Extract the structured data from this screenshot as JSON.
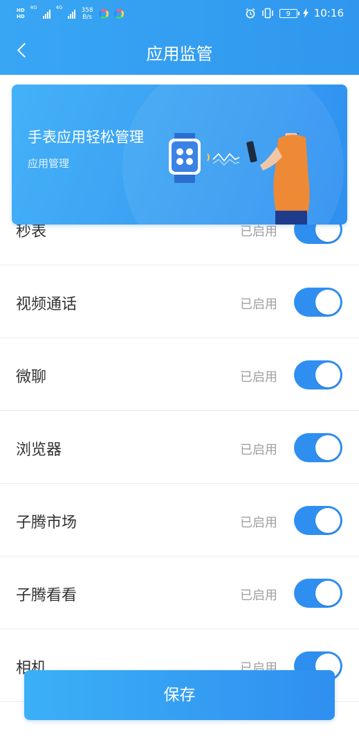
{
  "status_bar": {
    "hd1": "HD",
    "hd2": "HD",
    "net_type1": "4G",
    "net_type2": "4G",
    "speed_value": "358",
    "speed_unit": "B/s",
    "battery_level": "9",
    "time": "10:16"
  },
  "header": {
    "title": "应用监管"
  },
  "banner": {
    "title": "手表应用轻松管理",
    "subtitle": "应用管理"
  },
  "app_list": [
    {
      "name": "秒表",
      "status": "已启用",
      "enabled": true
    },
    {
      "name": "视频通话",
      "status": "已启用",
      "enabled": true
    },
    {
      "name": "微聊",
      "status": "已启用",
      "enabled": true
    },
    {
      "name": "浏览器",
      "status": "已启用",
      "enabled": true
    },
    {
      "name": "子腾市场",
      "status": "已启用",
      "enabled": true
    },
    {
      "name": "子腾看看",
      "status": "已启用",
      "enabled": true
    },
    {
      "name": "相机",
      "status": "已启用",
      "enabled": true
    }
  ],
  "footer": {
    "save_label": "保存"
  },
  "colors": {
    "primary": "#2f8ff0",
    "header_bg": "#39a6f4",
    "toggle_on": "#2f8ff0",
    "status_text": "#a0a0a0",
    "label_text": "#333333"
  },
  "icons": {
    "back": "chevron-left-icon",
    "alarm": "alarm-icon",
    "vibrate": "vibrate-icon",
    "battery": "battery-icon",
    "charging": "charging-icon"
  }
}
